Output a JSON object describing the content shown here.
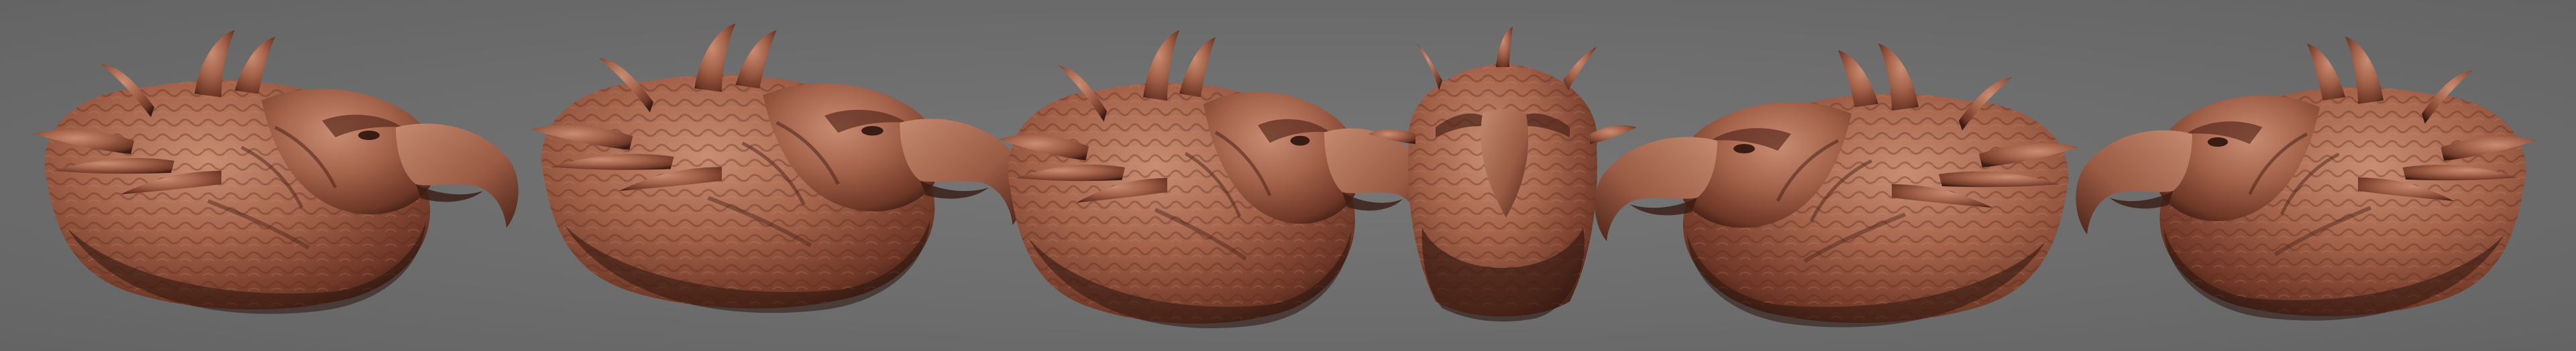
{
  "scene": {
    "background_color": "#6f6f6f",
    "clay_color": "#a4624a",
    "clay_highlight": "#c98d73",
    "clay_shadow": "#3a1c14",
    "views": [
      {
        "name": "left-three-quarter-view",
        "facing": "right"
      },
      {
        "name": "left-profile-view",
        "facing": "right"
      },
      {
        "name": "front-three-quarter-view",
        "facing": "right"
      },
      {
        "name": "front-view",
        "facing": "front"
      },
      {
        "name": "right-three-quarter-view",
        "facing": "left"
      },
      {
        "name": "right-rear-view",
        "facing": "left"
      }
    ]
  }
}
